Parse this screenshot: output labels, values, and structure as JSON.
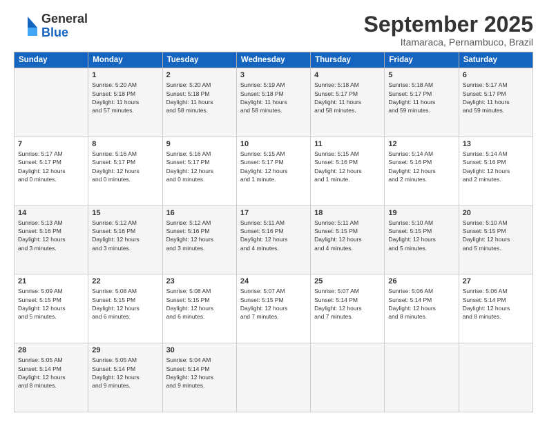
{
  "logo": {
    "general": "General",
    "blue": "Blue"
  },
  "title": "September 2025",
  "location": "Itamaraca, Pernambuco, Brazil",
  "headers": [
    "Sunday",
    "Monday",
    "Tuesday",
    "Wednesday",
    "Thursday",
    "Friday",
    "Saturday"
  ],
  "weeks": [
    [
      {
        "day": "",
        "info": ""
      },
      {
        "day": "1",
        "info": "Sunrise: 5:20 AM\nSunset: 5:18 PM\nDaylight: 11 hours\nand 57 minutes."
      },
      {
        "day": "2",
        "info": "Sunrise: 5:20 AM\nSunset: 5:18 PM\nDaylight: 11 hours\nand 58 minutes."
      },
      {
        "day": "3",
        "info": "Sunrise: 5:19 AM\nSunset: 5:18 PM\nDaylight: 11 hours\nand 58 minutes."
      },
      {
        "day": "4",
        "info": "Sunrise: 5:18 AM\nSunset: 5:17 PM\nDaylight: 11 hours\nand 58 minutes."
      },
      {
        "day": "5",
        "info": "Sunrise: 5:18 AM\nSunset: 5:17 PM\nDaylight: 11 hours\nand 59 minutes."
      },
      {
        "day": "6",
        "info": "Sunrise: 5:17 AM\nSunset: 5:17 PM\nDaylight: 11 hours\nand 59 minutes."
      }
    ],
    [
      {
        "day": "7",
        "info": "Sunrise: 5:17 AM\nSunset: 5:17 PM\nDaylight: 12 hours\nand 0 minutes."
      },
      {
        "day": "8",
        "info": "Sunrise: 5:16 AM\nSunset: 5:17 PM\nDaylight: 12 hours\nand 0 minutes."
      },
      {
        "day": "9",
        "info": "Sunrise: 5:16 AM\nSunset: 5:17 PM\nDaylight: 12 hours\nand 0 minutes."
      },
      {
        "day": "10",
        "info": "Sunrise: 5:15 AM\nSunset: 5:17 PM\nDaylight: 12 hours\nand 1 minute."
      },
      {
        "day": "11",
        "info": "Sunrise: 5:15 AM\nSunset: 5:16 PM\nDaylight: 12 hours\nand 1 minute."
      },
      {
        "day": "12",
        "info": "Sunrise: 5:14 AM\nSunset: 5:16 PM\nDaylight: 12 hours\nand 2 minutes."
      },
      {
        "day": "13",
        "info": "Sunrise: 5:14 AM\nSunset: 5:16 PM\nDaylight: 12 hours\nand 2 minutes."
      }
    ],
    [
      {
        "day": "14",
        "info": "Sunrise: 5:13 AM\nSunset: 5:16 PM\nDaylight: 12 hours\nand 3 minutes."
      },
      {
        "day": "15",
        "info": "Sunrise: 5:12 AM\nSunset: 5:16 PM\nDaylight: 12 hours\nand 3 minutes."
      },
      {
        "day": "16",
        "info": "Sunrise: 5:12 AM\nSunset: 5:16 PM\nDaylight: 12 hours\nand 3 minutes."
      },
      {
        "day": "17",
        "info": "Sunrise: 5:11 AM\nSunset: 5:16 PM\nDaylight: 12 hours\nand 4 minutes."
      },
      {
        "day": "18",
        "info": "Sunrise: 5:11 AM\nSunset: 5:15 PM\nDaylight: 12 hours\nand 4 minutes."
      },
      {
        "day": "19",
        "info": "Sunrise: 5:10 AM\nSunset: 5:15 PM\nDaylight: 12 hours\nand 5 minutes."
      },
      {
        "day": "20",
        "info": "Sunrise: 5:10 AM\nSunset: 5:15 PM\nDaylight: 12 hours\nand 5 minutes."
      }
    ],
    [
      {
        "day": "21",
        "info": "Sunrise: 5:09 AM\nSunset: 5:15 PM\nDaylight: 12 hours\nand 5 minutes."
      },
      {
        "day": "22",
        "info": "Sunrise: 5:08 AM\nSunset: 5:15 PM\nDaylight: 12 hours\nand 6 minutes."
      },
      {
        "day": "23",
        "info": "Sunrise: 5:08 AM\nSunset: 5:15 PM\nDaylight: 12 hours\nand 6 minutes."
      },
      {
        "day": "24",
        "info": "Sunrise: 5:07 AM\nSunset: 5:15 PM\nDaylight: 12 hours\nand 7 minutes."
      },
      {
        "day": "25",
        "info": "Sunrise: 5:07 AM\nSunset: 5:14 PM\nDaylight: 12 hours\nand 7 minutes."
      },
      {
        "day": "26",
        "info": "Sunrise: 5:06 AM\nSunset: 5:14 PM\nDaylight: 12 hours\nand 8 minutes."
      },
      {
        "day": "27",
        "info": "Sunrise: 5:06 AM\nSunset: 5:14 PM\nDaylight: 12 hours\nand 8 minutes."
      }
    ],
    [
      {
        "day": "28",
        "info": "Sunrise: 5:05 AM\nSunset: 5:14 PM\nDaylight: 12 hours\nand 8 minutes."
      },
      {
        "day": "29",
        "info": "Sunrise: 5:05 AM\nSunset: 5:14 PM\nDaylight: 12 hours\nand 9 minutes."
      },
      {
        "day": "30",
        "info": "Sunrise: 5:04 AM\nSunset: 5:14 PM\nDaylight: 12 hours\nand 9 minutes."
      },
      {
        "day": "",
        "info": ""
      },
      {
        "day": "",
        "info": ""
      },
      {
        "day": "",
        "info": ""
      },
      {
        "day": "",
        "info": ""
      }
    ]
  ]
}
